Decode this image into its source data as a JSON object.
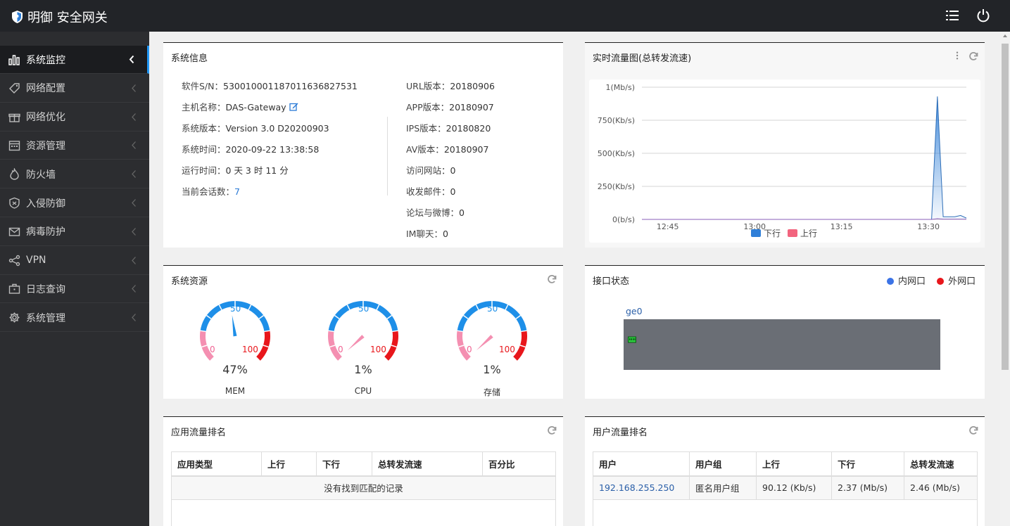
{
  "app": {
    "title": "明御 安全网关"
  },
  "sidebar": {
    "items": [
      {
        "label": "系统监控",
        "icon": "bar-chart-icon",
        "active": true
      },
      {
        "label": "网络配置",
        "icon": "tag-icon"
      },
      {
        "label": "网络优化",
        "icon": "gift-icon"
      },
      {
        "label": "资源管理",
        "icon": "calendar-icon"
      },
      {
        "label": "防火墙",
        "icon": "flame-icon"
      },
      {
        "label": "入侵防御",
        "icon": "shield-icon"
      },
      {
        "label": "病毒防护",
        "icon": "envelope-icon"
      },
      {
        "label": "VPN",
        "icon": "share-icon"
      },
      {
        "label": "日志查询",
        "icon": "briefcase-icon"
      },
      {
        "label": "系统管理",
        "icon": "gear-icon"
      }
    ]
  },
  "sysinfo": {
    "title": "系统信息",
    "left": [
      {
        "label": "软件S/N：",
        "value": "5300100011870116368275​31"
      },
      {
        "label": "主机名称：",
        "value": "DAS-Gateway"
      },
      {
        "label": "系统版本：",
        "value": "Version 3.0 D20200903"
      },
      {
        "label": "系统时间：",
        "value": "2020-09-22 13:38:58"
      },
      {
        "label": "运行时间：",
        "value": "0 天 3 时 11 分"
      },
      {
        "label": "当前会话数：",
        "value": "7"
      }
    ],
    "right": [
      {
        "label": "URL版本：",
        "value": "20180906"
      },
      {
        "label": "APP版本：",
        "value": "20180907"
      },
      {
        "label": "IPS版本：",
        "value": "20180820"
      },
      {
        "label": "AV版本：",
        "value": "20180907"
      },
      {
        "label": "访问网站：",
        "value": "0"
      },
      {
        "label": "收发邮件：",
        "value": "0"
      },
      {
        "label": "论坛与微博：",
        "value": "0"
      },
      {
        "label": "IM聊天：",
        "value": "0"
      }
    ]
  },
  "traffic": {
    "title": "实时流量图(总转发流速)"
  },
  "chart_data": {
    "type": "area",
    "y_ticks": [
      "1(Mb/s)",
      "750(Kb/s)",
      "500(Kb/s)",
      "250(Kb/s)",
      "0(b/s)"
    ],
    "y_tick_values": [
      1000,
      750,
      500,
      250,
      0
    ],
    "ylim": [
      0,
      1000
    ],
    "x_ticks": [
      "12:45",
      "13:00",
      "13:15",
      "13:30"
    ],
    "x_tick_values": [
      5,
      20,
      35,
      50
    ],
    "xlim": [
      2,
      58
    ],
    "legend": [
      "下行",
      "上行"
    ],
    "legend_colors": [
      "#2f7fd8",
      "#f2647e"
    ],
    "series": [
      {
        "name": "下行",
        "x": [
          2,
          10,
          20,
          30,
          40,
          50,
          52,
          53,
          54,
          55,
          56,
          57,
          58
        ],
        "values": [
          0,
          0,
          0,
          0,
          0,
          0,
          0,
          930,
          20,
          20,
          20,
          30,
          10
        ]
      },
      {
        "name": "上行",
        "x": [
          2,
          10,
          20,
          30,
          40,
          50,
          52,
          53,
          54,
          55,
          56,
          57,
          58
        ],
        "values": [
          0,
          0,
          0,
          0,
          0,
          0,
          0,
          5,
          2,
          2,
          2,
          2,
          1
        ]
      }
    ]
  },
  "resources": {
    "title": "系统资源",
    "gauges": [
      {
        "name": "MEM",
        "percent": 47,
        "percent_text": "47%",
        "min": "0",
        "mid": "50",
        "max": "100"
      },
      {
        "name": "CPU",
        "percent": 1,
        "percent_text": "1%",
        "min": "0",
        "mid": "50",
        "max": "100"
      },
      {
        "name": "存储",
        "percent": 1,
        "percent_text": "1%",
        "min": "0",
        "mid": "50",
        "max": "100"
      }
    ]
  },
  "interfaces": {
    "title": "接口状态",
    "legend_inner": "内网口",
    "legend_outer": "外网口",
    "inner_color": "#3b73e6",
    "outer_color": "#e8161b",
    "ports": [
      {
        "name": "ge0"
      }
    ]
  },
  "app_rank": {
    "title": "应用流量排名",
    "columns": [
      "应用类型",
      "上行",
      "下行",
      "总转发流速",
      "百分比"
    ],
    "empty_text": "没有找到匹配的记录"
  },
  "user_rank": {
    "title": "用户流量排名",
    "columns": [
      "用户",
      "用户组",
      "上行",
      "下行",
      "总转发流速"
    ],
    "rows": [
      [
        "192.168.255.250",
        "匿名用户组",
        "90.12 (Kb/s)",
        "2.37 (Mb/s)",
        "2.46 (Mb/s)"
      ]
    ]
  }
}
